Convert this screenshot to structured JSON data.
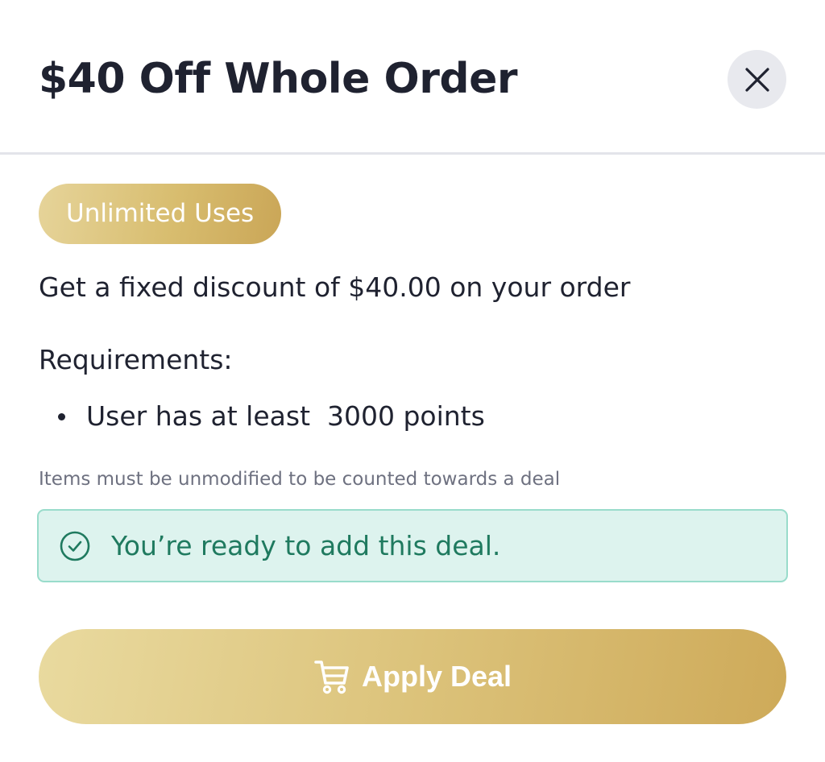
{
  "header": {
    "title": "$40 Off Whole Order",
    "close_icon": "close-icon"
  },
  "deal": {
    "badge": "Unlimited Uses",
    "description": "Get a fixed discount of $40.00 on your order",
    "requirements_heading": "Requirements:",
    "requirements": [
      {
        "text": "User has at least  3000 points"
      }
    ],
    "note": "Items must be unmodified to be counted towards a deal"
  },
  "status": {
    "icon": "check-circle-icon",
    "text": "You’re ready to add this deal."
  },
  "apply_button": {
    "icon": "cart-icon",
    "label": "Apply Deal"
  },
  "colors": {
    "text_primary": "#1f2230",
    "gold_light": "#e9da9f",
    "gold_dark": "#ceaa59",
    "success_bg": "#ddf3ee",
    "success_border": "#99dccb",
    "success_text": "#1f7a5f",
    "muted_text": "#6e7180",
    "close_bg": "#e8e9ee"
  }
}
